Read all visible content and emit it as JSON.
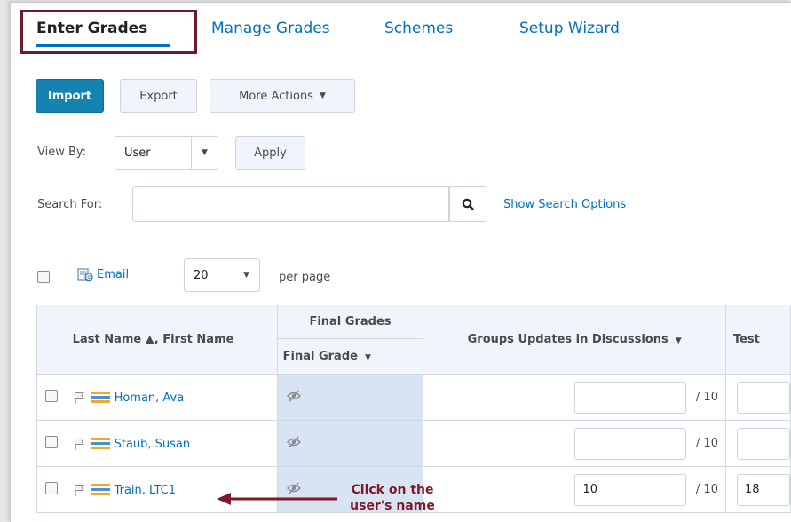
{
  "tabs": [
    {
      "label": "Enter Grades",
      "active": true
    },
    {
      "label": "Manage Grades"
    },
    {
      "label": "Schemes"
    },
    {
      "label": "Setup Wizard"
    }
  ],
  "toolbar": {
    "import_label": "Import",
    "export_label": "Export",
    "more_actions_label": "More Actions"
  },
  "view_by": {
    "label": "View By:",
    "selected": "User",
    "apply_label": "Apply"
  },
  "search": {
    "label": "Search For:",
    "value": "",
    "options_link": "Show Search Options"
  },
  "list_controls": {
    "email_label": "Email",
    "per_page_value": "20",
    "per_page_label": "per page"
  },
  "table": {
    "col_name": "Last Name ▲, First Name",
    "col_group_final": "Final Grades",
    "col_final_grade": "Final Grade",
    "col_groups_updates": "Groups Updates in Discussions",
    "col_test": "Test",
    "rows": [
      {
        "name": "Homan, Ava",
        "final_grade_icon": "hidden-eye-icon",
        "grade_value": "",
        "grade_max": "/ 10",
        "test_value": ""
      },
      {
        "name": "Staub, Susan",
        "final_grade_icon": "hidden-eye-icon",
        "grade_value": "",
        "grade_max": "/ 10",
        "test_value": ""
      },
      {
        "name": "Train, LTC1",
        "final_grade_icon": "hidden-eye-icon",
        "grade_value": "10",
        "grade_max": "/ 10",
        "test_value": "18"
      }
    ]
  },
  "annotation": {
    "text_line1": "Click on the",
    "text_line2": "user's name",
    "color": "#7c1a26"
  },
  "colors": {
    "link": "#006fbf",
    "primary": "#1583b2",
    "highlight_box": "#6e1b2a",
    "final_grade_cell": "#d8e3f3"
  }
}
